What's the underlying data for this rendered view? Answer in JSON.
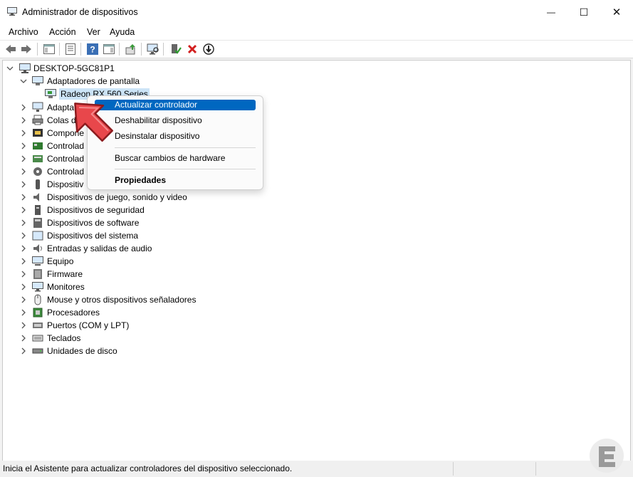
{
  "window": {
    "title": "Administrador de dispositivos"
  },
  "window_controls": {
    "minimize": "—",
    "maximize": "☐",
    "close": "✕"
  },
  "menu": [
    "Archivo",
    "Acción",
    "Ver",
    "Ayuda"
  ],
  "toolbar_icons": [
    "back-icon",
    "forward-icon",
    "show-hide-console-tree-icon",
    "properties-icon",
    "help-icon",
    "action-pane-icon",
    "update-driver-icon",
    "scan-hardware-icon",
    "enable-device-icon",
    "uninstall-device-icon",
    "disable-device-icon"
  ],
  "tree": {
    "root": "DESKTOP-5GC81P1",
    "expanded_category": "Adaptadores de pantalla",
    "selected_device": "Radeon RX 560 Series",
    "categories": [
      "Adaptadores de red",
      "Colas de impresión",
      "Componentes de software",
      "Controladoras ATA/ATAPI IDE",
      "Controladoras de almacenamiento",
      "Controladoras de bus serie universal",
      "Dispositivos de interfaz humana",
      "Dispositivos de juego, sonido y video",
      "Dispositivos de seguridad",
      "Dispositivos de software",
      "Dispositivos del sistema",
      "Entradas y salidas de audio",
      "Equipo",
      "Firmware",
      "Monitores",
      "Mouse y otros dispositivos señaladores",
      "Procesadores",
      "Puertos (COM y LPT)",
      "Teclados",
      "Unidades de disco"
    ],
    "visible_labels": [
      "Adaptador",
      "Colas de i",
      "Compone",
      "Controlad",
      "Controlad",
      "Controlad",
      "Dispositiv",
      "Dispositivos de juego, sonido y video",
      "Dispositivos de seguridad",
      "Dispositivos de software",
      "Dispositivos del sistema",
      "Entradas y salidas de audio",
      "Equipo",
      "Firmware",
      "Monitores",
      "Mouse y otros dispositivos señaladores",
      "Procesadores",
      "Puertos (COM y LPT)",
      "Teclados",
      "Unidades de disco"
    ]
  },
  "context_menu": {
    "items": [
      {
        "label": "Actualizar controlador",
        "highlighted": true
      },
      {
        "label": "Deshabilitar dispositivo"
      },
      {
        "label": "Desinstalar dispositivo"
      },
      {
        "label": "Buscar cambios de hardware"
      },
      {
        "label": "Propiedades",
        "bold": true
      }
    ]
  },
  "status": {
    "text": "Inicia el Asistente para actualizar controladores del dispositivo seleccionado."
  },
  "colors": {
    "accent": "#0067c0",
    "selection": "#cce4f7",
    "arrow": "#e8474b"
  }
}
